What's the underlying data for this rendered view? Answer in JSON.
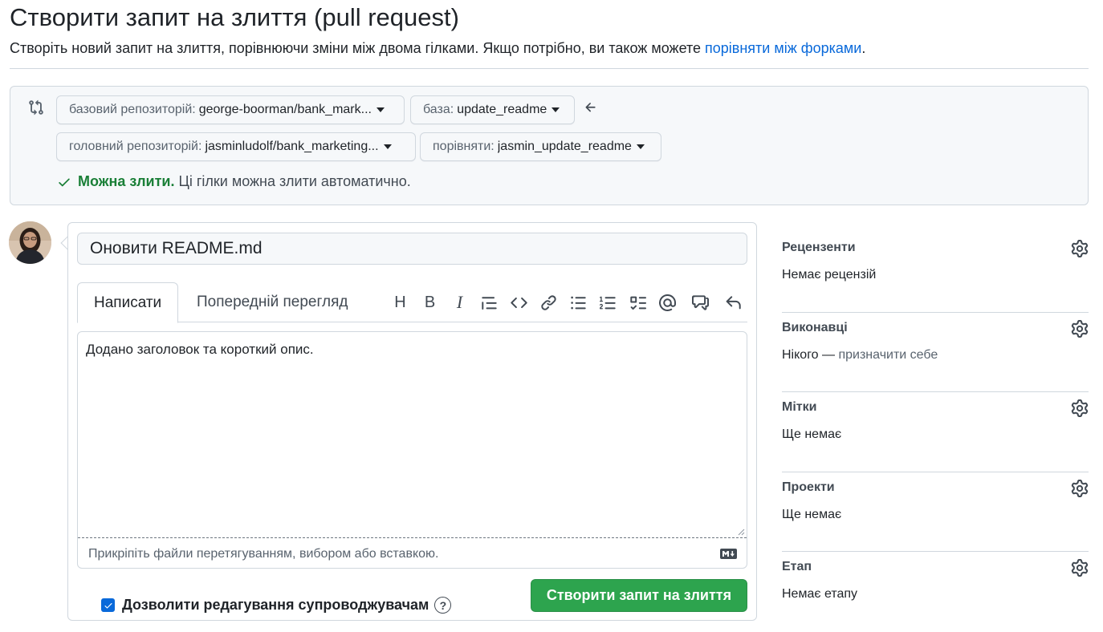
{
  "header": {
    "title": "Створити запит на злиття (pull request)",
    "subtitle": "Створіть новий запит на злиття, порівнюючи зміни між двома гілками. Якщо потрібно, ви також можете ",
    "subtitle_link": "порівняти між форками",
    "subtitle_end": "."
  },
  "compare": {
    "base_repo_label": "базовий репозиторій:",
    "base_repo_value": "george-boorman/bank_mark...",
    "base_label": "база:",
    "base_value": "update_readme",
    "head_repo_label": "головний репозиторій:",
    "head_repo_value": "jasminludolf/bank_marketing...",
    "compare_label": "порівняти:",
    "compare_value": "jasmin_update_readme",
    "status_ok": "Можна злити.",
    "status_text": "Ці гілки можна злити автоматично."
  },
  "form": {
    "title_value": "Оновити README.md",
    "tab_write": "Написати",
    "tab_preview": "Попередній перегляд",
    "toolbar": [
      "heading-icon",
      "bold-icon",
      "italic-icon",
      "quote-icon",
      "code-icon",
      "link-icon",
      "unordered-list-icon",
      "ordered-list-icon",
      "task-list-icon",
      "mention-icon",
      "cross-reference-icon",
      "reply-icon"
    ],
    "toolbar_heading": "H",
    "toolbar_bold": "B",
    "toolbar_italic": "I",
    "body_text": "Додано заголовок та короткий опис.",
    "attach_hint": "Прикріпіть файли перетягуванням, вибором або вставкою.",
    "allow_edits_label": "Дозволити редагування супроводжувачам",
    "allow_edits_checked": true,
    "submit_label": "Створити запит на злиття"
  },
  "sidebar": {
    "sections": [
      {
        "title": "Рецензенти",
        "value": "Немає рецензій",
        "link": ""
      },
      {
        "title": "Виконавці",
        "value": "Нікого — ",
        "link": "призначити себе"
      },
      {
        "title": "Мітки",
        "value": "Ще немає",
        "link": ""
      },
      {
        "title": "Проекти",
        "value": "Ще немає",
        "link": ""
      },
      {
        "title": "Етап",
        "value": "Немає етапу",
        "link": ""
      }
    ]
  },
  "colors": {
    "accent": "#0969da",
    "success": "#1a7f37",
    "button_green": "#2da44e",
    "border": "#d0d7de"
  }
}
